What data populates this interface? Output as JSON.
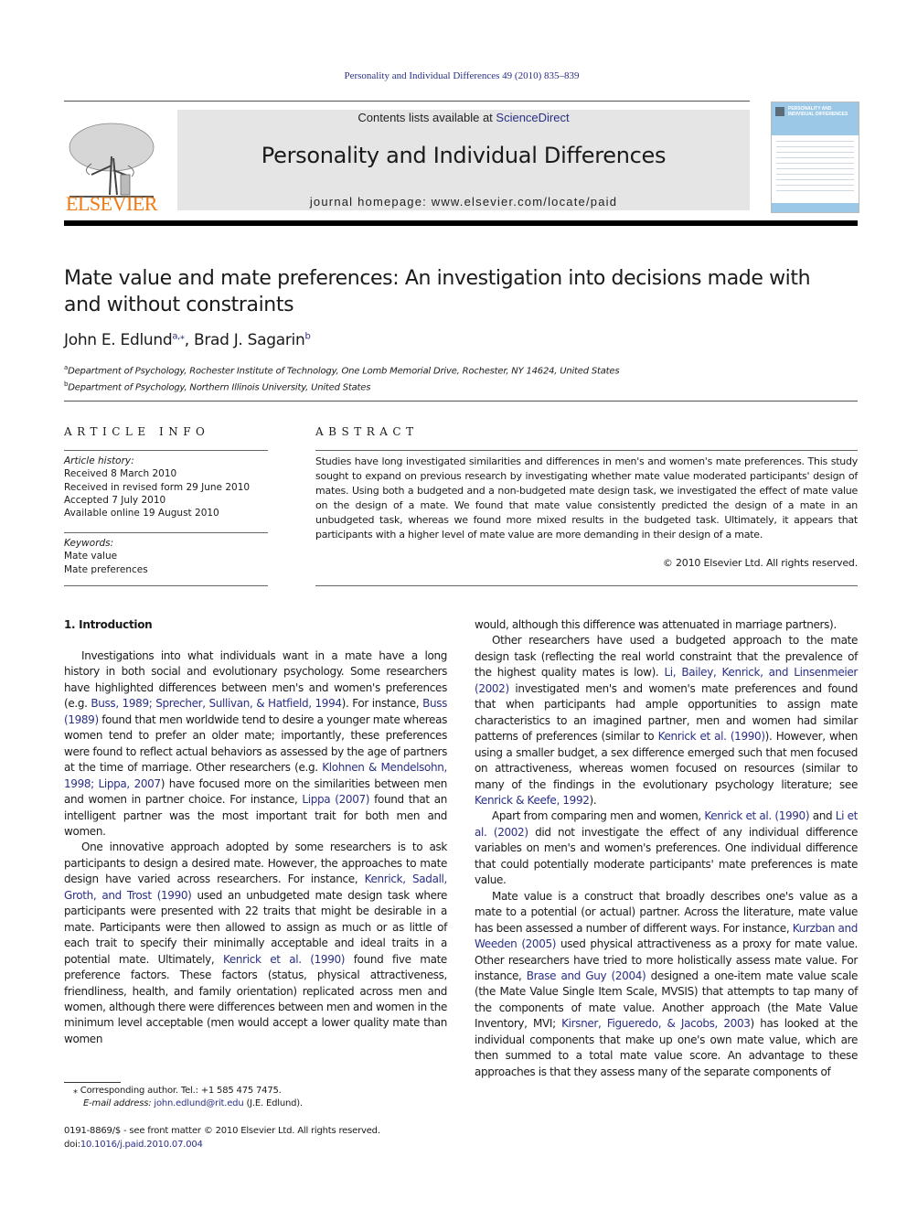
{
  "header": {
    "journal_reference": "Personality and Individual Differences 49 (2010) 835–839",
    "contents_prefix": "Contents lists available at ",
    "contents_link": "ScienceDirect",
    "journal_title": "Personality and Individual Differences",
    "homepage": "journal homepage: www.elsevier.com/locate/paid",
    "publisher_logo_text": "ELSEVIER",
    "cover_title_line1": "PERSONALITY AND",
    "cover_title_line2": "INDIVIDUAL DIFFERENCES",
    "colors": {
      "link": "#2a2f86",
      "elsevier_orange": "#f07a12",
      "masthead_bg": "#e5e5e5",
      "cover_blue": "#9cc8e8"
    }
  },
  "article": {
    "title": "Mate value and mate preferences: An investigation into decisions made with and without constraints",
    "authors": [
      {
        "name": "John E. Edlund",
        "sup": "a,⁎"
      },
      {
        "name": "Brad J. Sagarin",
        "sup": "b"
      }
    ],
    "affiliations": [
      {
        "key": "a",
        "text": "Department of Psychology, Rochester Institute of Technology, One Lomb Memorial Drive, Rochester, NY 14624, United States"
      },
      {
        "key": "b",
        "text": "Department of Psychology, Northern Illinois University, United States"
      }
    ]
  },
  "article_info": {
    "heading": "ARTICLE INFO",
    "history_label": "Article history:",
    "history": [
      "Received 8 March 2010",
      "Received in revised form 29 June 2010",
      "Accepted 7 July 2010",
      "Available online 19 August 2010"
    ],
    "keywords_label": "Keywords:",
    "keywords": [
      "Mate value",
      "Mate preferences"
    ]
  },
  "abstract": {
    "heading": "ABSTRACT",
    "text": "Studies have long investigated similarities and differences in men's and women's mate preferences. This study sought to expand on previous research by investigating whether mate value moderated participants' design of mates. Using both a budgeted and a non-budgeted mate design task, we investigated the effect of mate value on the design of a mate. We found that mate value consistently predicted the design of a mate in an unbudgeted task, whereas we found more mixed results in the budgeted task. Ultimately, it appears that participants with a higher level of mate value are more demanding in their design of a mate.",
    "copyright": "© 2010 Elsevier Ltd. All rights reserved."
  },
  "body": {
    "section_heading": "1. Introduction",
    "left": {
      "p1": [
        {
          "t": "Investigations into what individuals want in a mate have a long history in both social and evolutionary psychology. Some researchers have highlighted differences between men's and women's preferences (e.g. "
        },
        {
          "l": "Buss, 1989; Sprecher, Sullivan, & Hatfield, 1994"
        },
        {
          "t": "). For instance, "
        },
        {
          "l": "Buss (1989)"
        },
        {
          "t": " found that men worldwide tend to desire a younger mate whereas women tend to prefer an older mate; importantly, these preferences were found to reflect actual behaviors as assessed by the age of partners at the time of marriage. Other researchers (e.g. "
        },
        {
          "l": "Klohnen & Mendelsohn, 1998; Lippa, 2007"
        },
        {
          "t": ") have focused more on the similarities between men and women in partner choice. For instance, "
        },
        {
          "l": "Lippa (2007)"
        },
        {
          "t": " found that an intelligent partner was the most important trait for both men and women."
        }
      ],
      "p2": [
        {
          "t": "One innovative approach adopted by some researchers is to ask participants to design a desired mate. However, the approaches to mate design have varied across researchers. For instance, "
        },
        {
          "l": "Kenrick, Sadall, Groth, and Trost (1990)"
        },
        {
          "t": " used an unbudgeted mate design task where participants were presented with 22 traits that might be desirable in a mate. Participants were then allowed to assign as much or as little of each trait to specify their minimally acceptable and ideal traits in a potential mate. Ultimately, "
        },
        {
          "l": "Kenrick et al. (1990)"
        },
        {
          "t": " found five mate preference factors. These factors (status, physical attractiveness, friendliness, health, and family orientation) replicated across men and women, although there were differences between men and women in the minimum level acceptable (men would accept a lower quality mate than women"
        }
      ]
    },
    "right": {
      "p0": [
        {
          "t": "would, although this difference was attenuated in marriage partners)."
        }
      ],
      "p1": [
        {
          "t": "Other researchers have used a budgeted approach to the mate design task (reflecting the real world constraint that the prevalence of the highest quality mates is low). "
        },
        {
          "l": "Li, Bailey, Kenrick, and Linsenmeier (2002)"
        },
        {
          "t": " investigated men's and women's mate preferences and found that when participants had ample opportunities to assign mate characteristics to an imagined partner, men and women had similar patterns of preferences (similar to "
        },
        {
          "l": "Kenrick et al. (1990)"
        },
        {
          "t": "). However, when using a smaller budget, a sex difference emerged such that men focused on attractiveness, whereas women focused on resources (similar to many of the findings in the evolutionary psychology literature; see "
        },
        {
          "l": "Kenrick & Keefe, 1992"
        },
        {
          "t": ")."
        }
      ],
      "p2": [
        {
          "t": "Apart from comparing men and women, "
        },
        {
          "l": "Kenrick et al. (1990)"
        },
        {
          "t": " and "
        },
        {
          "l": "Li et al. (2002)"
        },
        {
          "t": " did not investigate the effect of any individual difference variables on men's and women's preferences. One individual difference that could potentially moderate participants' mate preferences is mate value."
        }
      ],
      "p3": [
        {
          "t": "Mate value is a construct that broadly describes one's value as a mate to a potential (or actual) partner. Across the literature, mate value has been assessed a number of different ways. For instance, "
        },
        {
          "l": "Kurzban and Weeden (2005)"
        },
        {
          "t": " used physical attractiveness as a proxy for mate value. Other researchers have tried to more holistically assess mate value. For instance, "
        },
        {
          "l": "Brase and Guy (2004)"
        },
        {
          "t": " designed a one-item mate value scale (the Mate Value Single Item Scale, MVSIS) that attempts to tap many of the components of mate value. Another approach (the Mate Value Inventory, MVI; "
        },
        {
          "l": "Kirsner, Figueredo, & Jacobs, 2003"
        },
        {
          "t": ") has looked at the individual components that make up one's own mate value, which are then summed to a total mate value score. An advantage to these approaches is that they assess many of the separate components of"
        }
      ]
    }
  },
  "footnote": {
    "marker": "⁎",
    "corresponding": "Corresponding author. Tel.: +1 585 475 7475.",
    "email_label": "E-mail address: ",
    "email": "john.edlund@rit.edu",
    "email_suffix": " (J.E. Edlund)."
  },
  "front_matter": {
    "issn_line": "0191-8869/$ - see front matter © 2010 Elsevier Ltd. All rights reserved.",
    "doi_prefix": "doi:",
    "doi": "10.1016/j.paid.2010.07.004"
  }
}
